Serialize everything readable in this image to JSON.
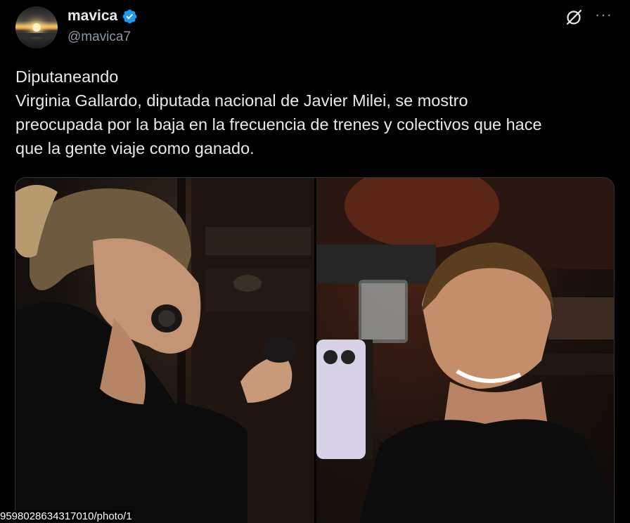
{
  "author": {
    "display_name": "mavica",
    "handle": "@mavica7",
    "verified": true,
    "avatar_icon": "sunset-avatar"
  },
  "header_icons": [
    "grok-icon",
    "more-options-icon"
  ],
  "tweet": {
    "lines": [
      "Diputaneando",
      "Virginia Gallardo, diputada nacional de Javier Milei, se mostro",
      "preocupada por la baja en la frecuencia de trenes y colectivos que hace",
      "que la gente viaje como ganado."
    ]
  },
  "media": {
    "count": 2
  },
  "status_url": "9598028634317010/photo/1",
  "colors": {
    "background": "#000000",
    "text": "#e7e9ea",
    "secondary": "#8b98a5",
    "verified_badge": "#1d9bf0"
  }
}
